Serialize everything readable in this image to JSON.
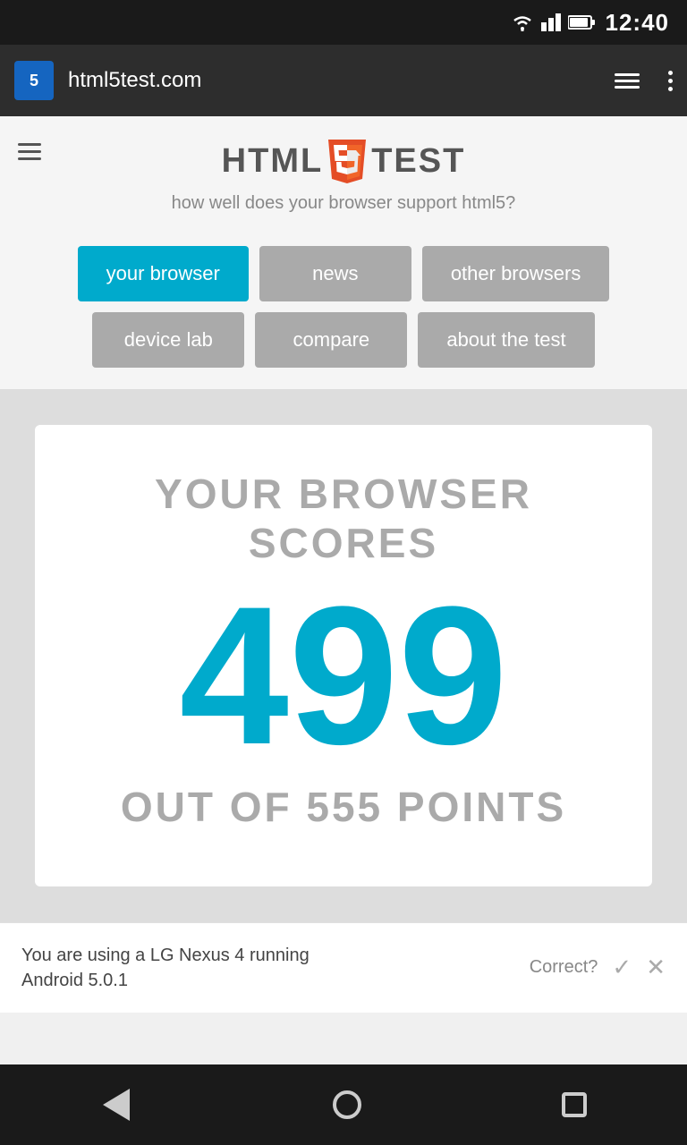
{
  "statusBar": {
    "time": "12:40"
  },
  "browserToolbar": {
    "faviconText": "5",
    "url": "html5test.com",
    "menuLabel": "menu",
    "dotsLabel": "more"
  },
  "header": {
    "logoLeft": "HTML",
    "logoRight": "TEST",
    "tagline": "how well does your browser support html5?"
  },
  "navButtons": [
    {
      "id": "your-browser",
      "label": "your browser",
      "active": true
    },
    {
      "id": "news",
      "label": "news",
      "active": false
    },
    {
      "id": "other-browsers",
      "label": "other browsers",
      "active": false
    },
    {
      "id": "device-lab",
      "label": "device lab",
      "active": false
    },
    {
      "id": "compare",
      "label": "compare",
      "active": false
    },
    {
      "id": "about-the-test",
      "label": "about the test",
      "active": false
    }
  ],
  "scoreCard": {
    "titleLine1": "YOUR BROWSER SCORES",
    "score": "499",
    "subtitleLine1": "OUT OF 555 POINTS"
  },
  "deviceInfo": {
    "text": "You are using a LG Nexus 4 running\nAndroid 5.0.1",
    "correctLabel": "Correct?",
    "checkIcon": "✓",
    "closeIcon": "✕"
  },
  "bottomNav": {
    "backLabel": "back",
    "homeLabel": "home",
    "recentLabel": "recent"
  }
}
